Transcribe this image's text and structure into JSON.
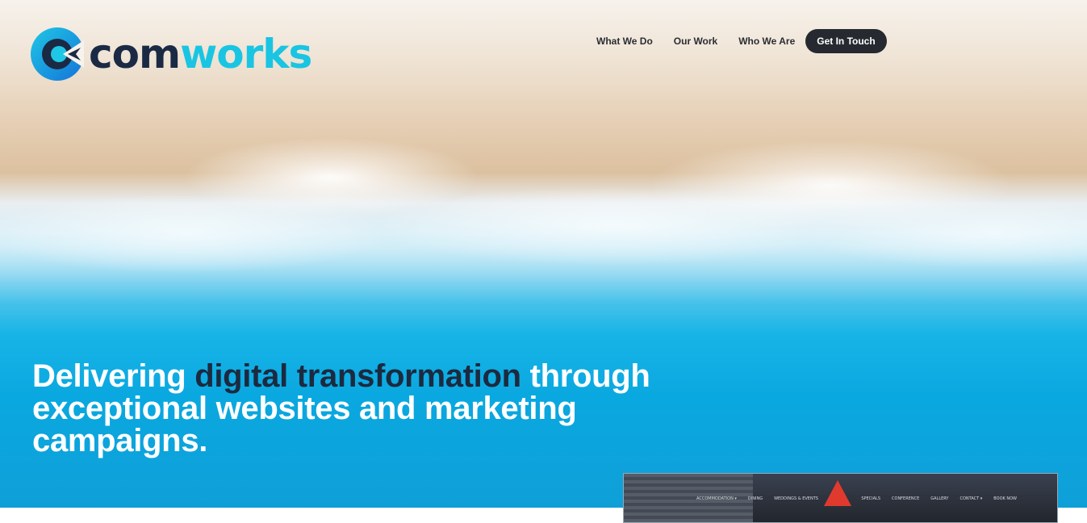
{
  "brand": {
    "name_part1": "com",
    "name_part2": "works",
    "colors": {
      "dark": "#1b2a44",
      "cyan": "#19c5e2"
    }
  },
  "nav": {
    "links": [
      "What We Do",
      "Our Work",
      "Who We Are"
    ],
    "cta": "Get In Touch"
  },
  "hero": {
    "headline_before": "Delivering ",
    "headline_accent": "digital transformation",
    "headline_after": " through exceptional websites and marketing campaigns."
  },
  "preview": {
    "menu_left": [
      "ACCOMMODATION ▾",
      "DINING",
      "WEDDINGS & EVENTS"
    ],
    "menu_right": [
      "SPECIALS",
      "CONFERENCE",
      "GALLERY",
      "CONTACT ▾",
      "BOOK NOW"
    ]
  }
}
